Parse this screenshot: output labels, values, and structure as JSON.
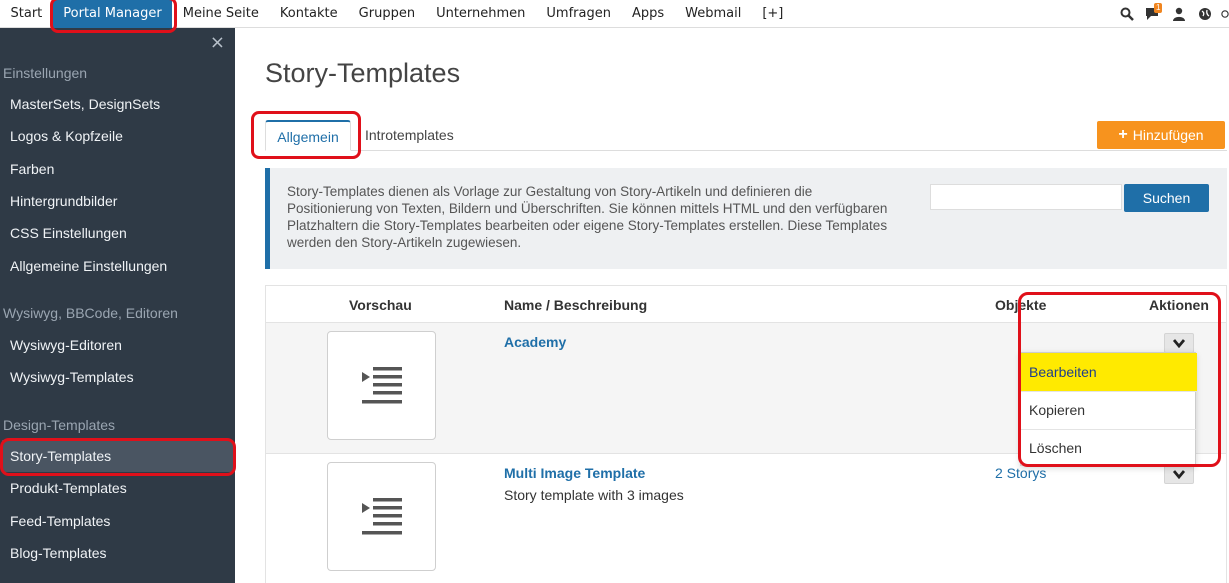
{
  "topnav": {
    "items": [
      "Start",
      "Portal Manager",
      "Meine Seite",
      "Kontakte",
      "Gruppen",
      "Unternehmen",
      "Umfragen",
      "Apps",
      "Webmail",
      "[+]"
    ],
    "active": "Portal Manager",
    "notification_count": "1",
    "icons": [
      "search-icon",
      "chat-icon",
      "user-icon",
      "globe-icon"
    ]
  },
  "sidebar": {
    "close_symbol": "×",
    "groups": [
      {
        "title": "Einstellungen",
        "items": [
          "MasterSets, DesignSets",
          "Logos & Kopfzeile",
          "Farben",
          "Hintergrundbilder",
          "CSS Einstellungen",
          "Allgemeine Einstellungen"
        ]
      },
      {
        "title": "Wysiwyg, BBCode, Editoren",
        "items": [
          "Wysiwyg-Editoren",
          "Wysiwyg-Templates"
        ]
      },
      {
        "title": "Design-Templates",
        "items": [
          "Story-Templates",
          "Produkt-Templates",
          "Feed-Templates",
          "Blog-Templates"
        ]
      }
    ],
    "active_item": "Story-Templates"
  },
  "main": {
    "title": "Story-Templates",
    "tabs": [
      "Allgemein",
      "Introtemplates"
    ],
    "active_tab": "Allgemein",
    "add_button": "Hinzufügen",
    "info_text": "Story-Templates dienen als Vorlage zur Gestaltung von Story-Artikeln und definieren die Positionierung von Texten, Bildern und Überschriften. Sie können mittels HTML und den verfügbaren Platzhaltern die Story-Templates bearbeiten oder eigene Story-Templates erstellen. Diese Templates werden den Story-Artikeln zugewiesen.",
    "search": {
      "value": "",
      "button": "Suchen"
    },
    "table": {
      "headers": {
        "preview": "Vorschau",
        "name": "Name / Beschreibung",
        "objects": "Objekte",
        "actions": "Aktionen"
      },
      "rows": [
        {
          "name": "Academy",
          "description": "",
          "objects": ""
        },
        {
          "name": "Multi Image Template",
          "description": "Story template with 3 images",
          "objects": "2 Storys"
        }
      ]
    },
    "action_menu": [
      "Bearbeiten",
      "Kopieren",
      "Löschen"
    ]
  },
  "colors": {
    "accent": "#1f6fa8",
    "sidebar_bg": "#2f3a46",
    "add_button": "#f7931e",
    "highlight": "#ffea00",
    "annotation": "#e0101a"
  }
}
